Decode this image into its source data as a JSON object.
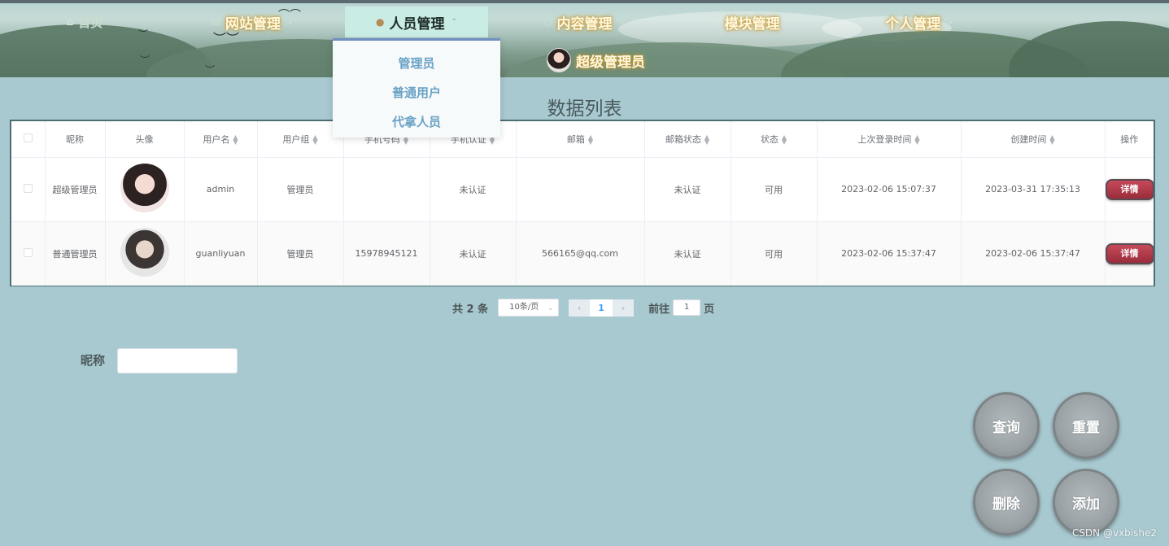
{
  "nav": {
    "home": "首页",
    "site": "网站管理",
    "people": "人员管理",
    "content": "内容管理",
    "module": "模块管理",
    "personal": "个人管理"
  },
  "user": {
    "name": "超级管理员"
  },
  "dropdown": [
    "管理员",
    "普通用户",
    "代拿人员"
  ],
  "page_title": "数据列表",
  "table": {
    "headers": [
      "昵称",
      "头像",
      "用户名",
      "用户组",
      "手机号码",
      "手机认证",
      "邮箱",
      "邮箱状态",
      "状态",
      "上次登录时间",
      "创建时间",
      "操作"
    ],
    "rows": [
      {
        "nickname": "超级管理员",
        "username": "admin",
        "group": "管理员",
        "phone": "",
        "phone_auth": "未认证",
        "email": "",
        "email_status": "未认证",
        "status": "可用",
        "last_login": "2023-02-06 15:07:37",
        "created": "2023-03-31 17:35:13",
        "action": "详情"
      },
      {
        "nickname": "普通管理员",
        "username": "guanliyuan",
        "group": "管理员",
        "phone": "15978945121",
        "phone_auth": "未认证",
        "email": "566165@qq.com",
        "email_status": "未认证",
        "status": "可用",
        "last_login": "2023-02-06 15:37:47",
        "created": "2023-02-06 15:37:47",
        "action": "详情"
      }
    ]
  },
  "pager": {
    "total": "共 2 条",
    "page_size": "10条/页",
    "current": "1",
    "goto_label": "前往",
    "goto_value": "1",
    "unit": "页"
  },
  "search": {
    "label": "昵称",
    "value": ""
  },
  "buttons": {
    "query": "查询",
    "reset": "重置",
    "delete": "删除",
    "add": "添加"
  },
  "watermark": "CSDN @vxbishe2"
}
